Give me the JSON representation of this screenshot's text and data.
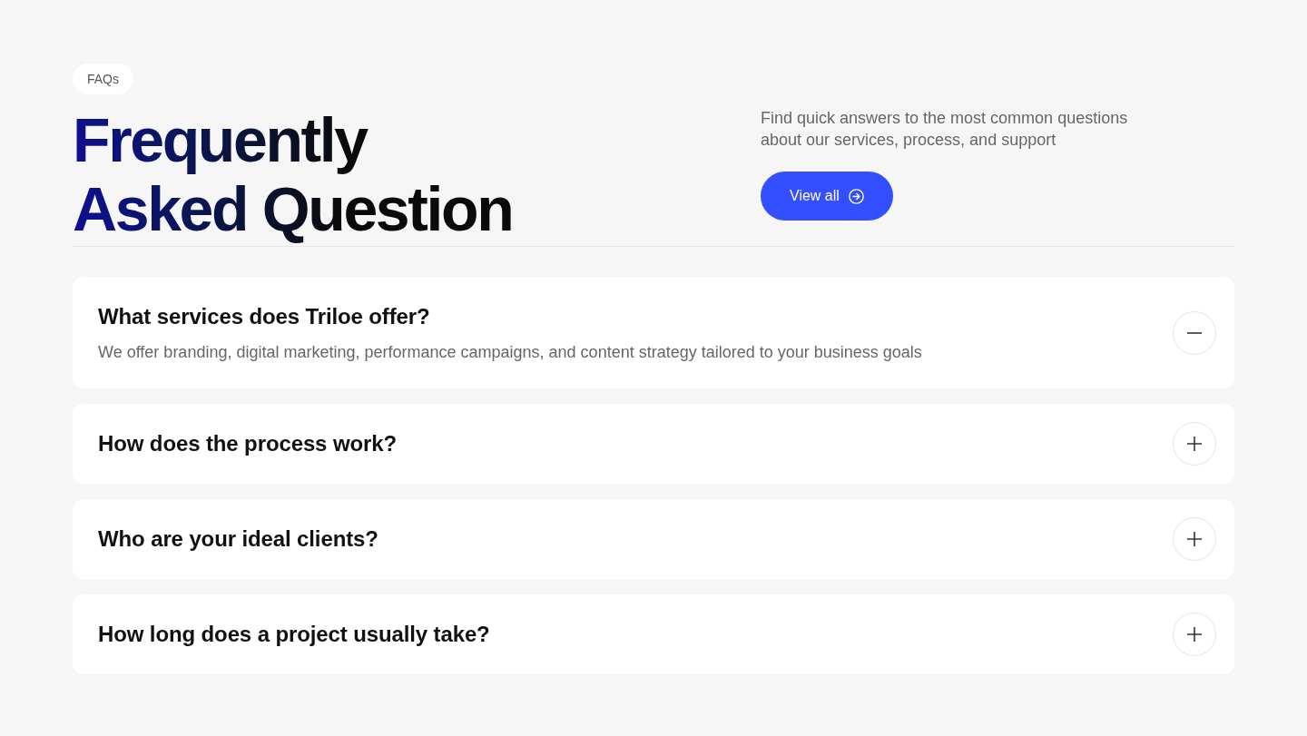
{
  "badge": "FAQs",
  "heading": "Frequently Asked Question",
  "intro": "Find quick answers to the most common questions about our services, process, and support",
  "view_all_button": {
    "label": "View all"
  },
  "faqs": [
    {
      "question": "What services does Triloe offer?",
      "answer": "We offer branding, digital marketing, performance campaigns, and content strategy tailored to your business goals",
      "expanded": true
    },
    {
      "question": "How does the process work?",
      "expanded": false
    },
    {
      "question": "Who are your ideal clients?",
      "expanded": false
    },
    {
      "question": "How long does a project usually take?",
      "expanded": false
    }
  ]
}
